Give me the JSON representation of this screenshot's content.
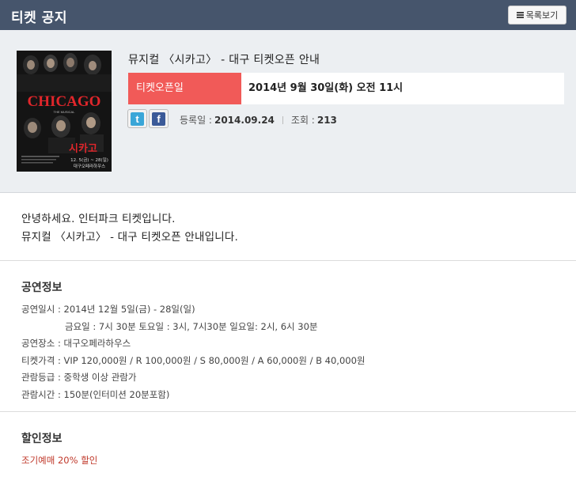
{
  "header": {
    "title": "티켓 공지",
    "list_button": "목록보기"
  },
  "notice": {
    "title": "뮤지컬 〈시카고〉 - 대구 티켓오픈 안내",
    "open_label": "티켓오픈일",
    "open_value": "2014년 9월 30일(화) 오전 11시",
    "reg_label": "등록일 :",
    "reg_date": "2014.09.24",
    "views_label": "조회 :",
    "views": "213"
  },
  "poster": {
    "logo": "CHICAGO",
    "korean_title": "시카고",
    "date_text": "12. 5(금) ~ 28(일)",
    "venue_text": "대구오페라하우스"
  },
  "greeting": {
    "line1": "안녕하세요. 인터파크 티켓입니다.",
    "line2": "뮤지컬 〈시카고〉 - 대구 티켓오픈 안내입니다."
  },
  "performance": {
    "heading": "공연정보",
    "rows": [
      "공연일시 : 2014년 12월 5일(금) - 28일(일)",
      "금요일 : 7시 30분 토요일 : 3시, 7시30분 일요일: 2시, 6시 30분",
      "공연장소 : 대구오페라하우스",
      "티켓가격 : VIP 120,000원 / R 100,000원 / S 80,000원 / A 60,000원 / B 40,000원",
      "관람등급 : 중학생 이상 관람가",
      "관람시간 : 150분(인터미션 20분포함)"
    ]
  },
  "discount": {
    "heading": "할인정보",
    "text": "조기예매 20% 할인"
  },
  "colors": {
    "header_bg": "#46556c",
    "accent": "#f15a58",
    "discount_text": "#c0392b"
  }
}
